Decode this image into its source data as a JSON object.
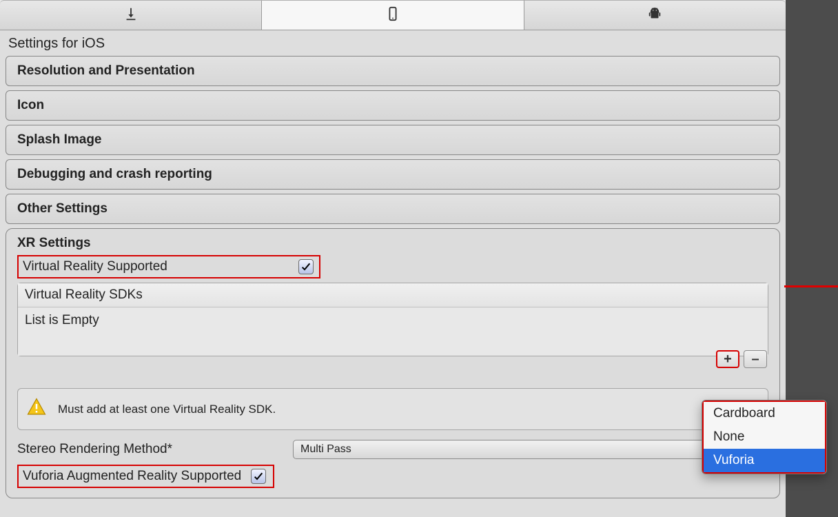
{
  "heading": "Settings for iOS",
  "sections": {
    "resolution": "Resolution and Presentation",
    "icon": "Icon",
    "splash": "Splash Image",
    "debug": "Debugging and crash reporting",
    "other": "Other Settings"
  },
  "xr": {
    "title": "XR Settings",
    "vr_supported_label": "Virtual Reality Supported",
    "sdk_header": "Virtual Reality SDKs",
    "sdk_empty": "List is Empty",
    "warning": "Must add at least one Virtual Reality SDK.",
    "stereo_label": "Stereo Rendering Method*",
    "stereo_value": "Multi Pass",
    "vuforia_label": "Vuforia Augmented Reality Supported"
  },
  "popup": {
    "cardboard": "Cardboard",
    "none": "None",
    "vuforia": "Vuforia"
  },
  "icons": {
    "download": "download-icon",
    "phone": "phone-icon",
    "android": "android-icon",
    "plus": "+",
    "minus": "–"
  }
}
